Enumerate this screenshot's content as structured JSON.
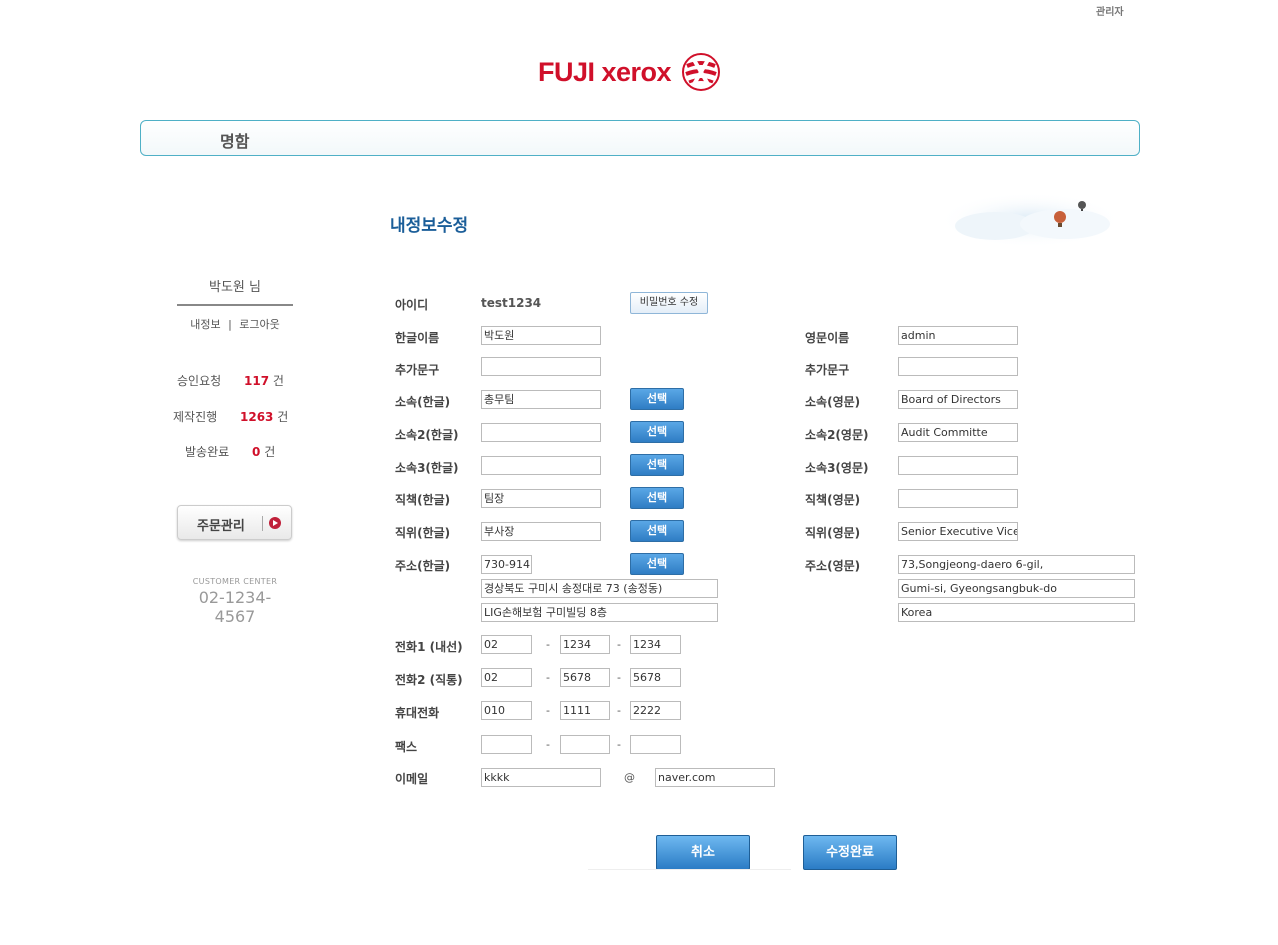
{
  "header": {
    "admin_link": "관리자",
    "logo_text": "FUJI xerox",
    "nav_title": "명함"
  },
  "page": {
    "heading": "내정보수정"
  },
  "sidebar": {
    "user_name": "박도원 님",
    "my_info": "내정보",
    "separator": "|",
    "logout": "로그아웃",
    "stats": [
      {
        "label": "승인요청",
        "count": "117",
        "unit": "건"
      },
      {
        "label": "제작진행",
        "count": "1263",
        "unit": "건"
      },
      {
        "label": "발송완료",
        "count": "0",
        "unit": "건"
      }
    ],
    "order_button": "주문관리",
    "customer_center_label": "CUSTOMER CENTER",
    "customer_center_phone": "02-1234-4567"
  },
  "form": {
    "id_label": "아이디",
    "id_value": "test1234",
    "password_button": "비밀번호 수정",
    "select_label": "선택",
    "name_kr_label": "한글이름",
    "name_kr": "박도원",
    "name_en_label": "영문이름",
    "name_en": "admin",
    "extra_kr_label": "추가문구",
    "extra_kr": "",
    "extra_en_label": "추가문구",
    "extra_en": "",
    "dept_kr_label": "소속(한글)",
    "dept_kr": "총무팀",
    "dept_en_label": "소속(영문)",
    "dept_en": "Board of Directors",
    "dept2_kr_label": "소속2(한글)",
    "dept2_kr": "",
    "dept2_en_label": "소속2(영문)",
    "dept2_en": "Audit Committe",
    "dept3_kr_label": "소속3(한글)",
    "dept3_kr": "",
    "dept3_en_label": "소속3(영문)",
    "dept3_en": "",
    "duty_kr_label": "직책(한글)",
    "duty_kr": "팀장",
    "duty_en_label": "직책(영문)",
    "duty_en": "",
    "rank_kr_label": "직위(한글)",
    "rank_kr": "부사장",
    "rank_en_label": "직위(영문)",
    "rank_en": "Senior Executive Vice",
    "addr_kr_label": "주소(한글)",
    "zip": "730-914",
    "addr_kr_1": "경상북도 구미시 송정대로 73 (송정동)",
    "addr_kr_2": "LIG손해보험 구미빌딩 8층",
    "addr_en_label": "주소(영문)",
    "addr_en_1": "73,Songjeong-daero 6-gil,",
    "addr_en_2": "Gumi-si, Gyeongsangbuk-do",
    "addr_en_3": "Korea",
    "tel1_label": "전화1 (내선)",
    "tel1": [
      "02",
      "1234",
      "1234"
    ],
    "tel2_label": "전화2 (직통)",
    "tel2": [
      "02",
      "5678",
      "5678"
    ],
    "mobile_label": "휴대전화",
    "mobile": [
      "010",
      "1111",
      "2222"
    ],
    "fax_label": "팩스",
    "fax": [
      "",
      "",
      ""
    ],
    "email_label": "이메일",
    "email_user": "kkkk",
    "email_at": "@",
    "email_domain": "naver.com",
    "dash": "-"
  },
  "actions": {
    "cancel": "취소",
    "submit": "수정완료"
  },
  "colors": {
    "brand_red": "#d0102a",
    "accent_blue": "#2f7dc4",
    "heading_blue": "#1b5e99"
  }
}
